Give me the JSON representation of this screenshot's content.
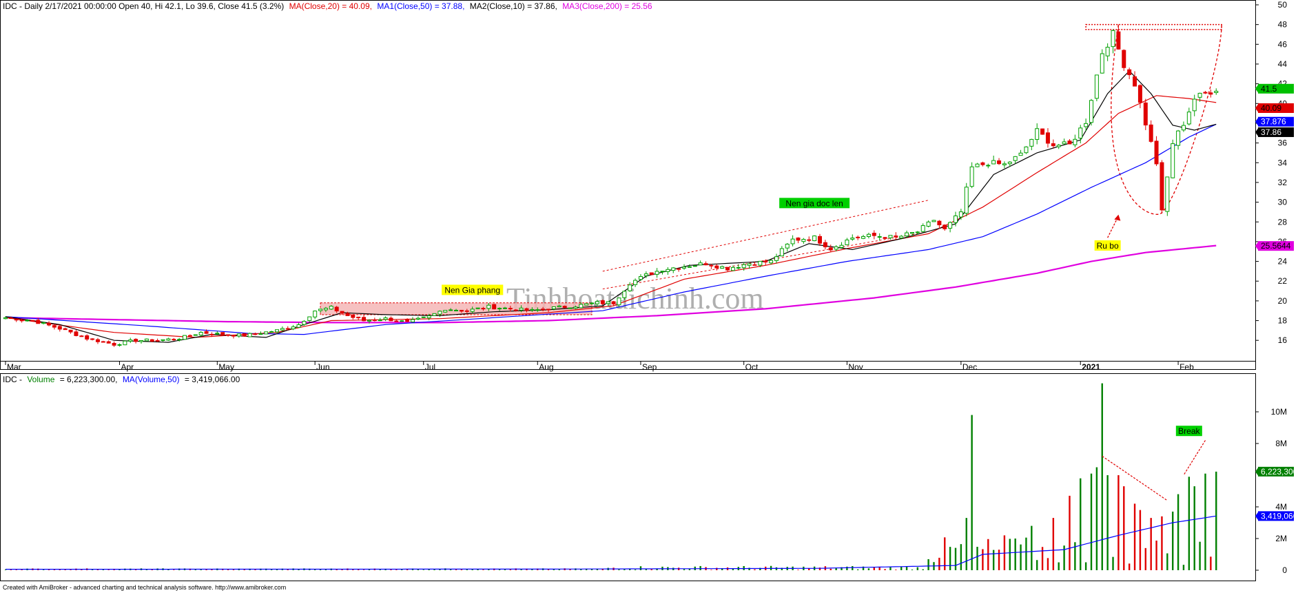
{
  "header": {
    "price_line": {
      "base": "IDC - Daily 2/17/2021 00:00:00 Open 40, Hi 42.1, Lo 39.6, Close 41.5 (3.2%)",
      "ma20": "MA(Close,20) = 40.09,",
      "ma50": "MA1(Close,50) = 37.88,",
      "ma10": "MA2(Close,10) = 37.86,",
      "ma200": "MA3(Close,200) = 25.56"
    },
    "volume_line": {
      "base": "IDC -",
      "vol_label": "Volume",
      "vol_value": "= 6,223,300.00,",
      "vol_ma": "MA(Volume,50)",
      "vol_ma_value": "= 3,419,066.00"
    }
  },
  "footer": "Created with AmiBroker - advanced charting and technical analysis software. http://www.amibroker.com",
  "watermark": "Tinhhoataichinh.com",
  "colors": {
    "up_candle": "#00a000",
    "down_candle": "#e00000",
    "ma20": "#e00000",
    "ma50": "#0000ff",
    "ma10": "#000000",
    "ma200": "#e000e0",
    "vol_up": "#008000",
    "vol_down": "#e00000",
    "vol_ma": "#0000ff",
    "zone_fill": "#f4b6b6"
  },
  "chart_data": [
    {
      "type": "line",
      "subtype": "candlestick",
      "title": "IDC - Daily",
      "ylim": [
        14.2,
        50
      ],
      "y_ticks": [
        16,
        18,
        20,
        22,
        24,
        26,
        28,
        30,
        32,
        34,
        36,
        38,
        40,
        42,
        44,
        46,
        48,
        50
      ],
      "months": [
        {
          "label": "Mar",
          "bar": 0
        },
        {
          "label": "Apr",
          "bar": 21
        },
        {
          "label": "May",
          "bar": 39
        },
        {
          "label": "Jun",
          "bar": 57
        },
        {
          "label": "Jul",
          "bar": 77
        },
        {
          "label": "Aug",
          "bar": 98
        },
        {
          "label": "Sep",
          "bar": 117
        },
        {
          "label": "Oct",
          "bar": 136
        },
        {
          "label": "Nov",
          "bar": 155
        },
        {
          "label": "Dec",
          "bar": 176
        },
        {
          "label": "2021",
          "bar": 198
        },
        {
          "label": "Feb",
          "bar": 216
        }
      ],
      "bar_count": 224,
      "anchors": {
        "close": [
          [
            0,
            18.3
          ],
          [
            5,
            18.0
          ],
          [
            10,
            17.2
          ],
          [
            15,
            16.2
          ],
          [
            20,
            15.6
          ],
          [
            24,
            16.0
          ],
          [
            28,
            16.0
          ],
          [
            32,
            16.2
          ],
          [
            36,
            16.8
          ],
          [
            40,
            16.6
          ],
          [
            44,
            16.5
          ],
          [
            50,
            17.0
          ],
          [
            54,
            17.6
          ],
          [
            57,
            19.0
          ],
          [
            60,
            19.3
          ],
          [
            63,
            18.5
          ],
          [
            66,
            18.0
          ],
          [
            70,
            18.2
          ],
          [
            74,
            17.8
          ],
          [
            78,
            18.4
          ],
          [
            81,
            19.2
          ],
          [
            85,
            19.0
          ],
          [
            89,
            19.4
          ],
          [
            93,
            19.2
          ],
          [
            97,
            19.0
          ],
          [
            101,
            19.3
          ],
          [
            105,
            19.5
          ],
          [
            109,
            19.8
          ],
          [
            112,
            19.8
          ],
          [
            115,
            21.8
          ],
          [
            118,
            22.6
          ],
          [
            121,
            23.2
          ],
          [
            125,
            23.5
          ],
          [
            129,
            23.8
          ],
          [
            133,
            23.3
          ],
          [
            137,
            23.8
          ],
          [
            141,
            24.0
          ],
          [
            145,
            26.2
          ],
          [
            149,
            26.4
          ],
          [
            152,
            25.3
          ],
          [
            156,
            26.4
          ],
          [
            160,
            26.6
          ],
          [
            164,
            26.4
          ],
          [
            168,
            27.0
          ],
          [
            171,
            28.2
          ],
          [
            173,
            27.2
          ],
          [
            176,
            29.0
          ],
          [
            178,
            33.5
          ],
          [
            181,
            34.0
          ],
          [
            184,
            33.8
          ],
          [
            187,
            34.8
          ],
          [
            190,
            37.2
          ],
          [
            193,
            35.8
          ],
          [
            196,
            35.8
          ],
          [
            199,
            38.2
          ],
          [
            202,
            45.2
          ],
          [
            204,
            47.0
          ],
          [
            206,
            44.0
          ],
          [
            208,
            42.0
          ],
          [
            210,
            38.0
          ],
          [
            212,
            34.0
          ],
          [
            213,
            29.0
          ],
          [
            215,
            36.0
          ],
          [
            217,
            38.0
          ],
          [
            219,
            40.5
          ],
          [
            221,
            41.0
          ],
          [
            223,
            41.5
          ]
        ],
        "ma20": [
          [
            0,
            18.3
          ],
          [
            20,
            16.8
          ],
          [
            35,
            16.3
          ],
          [
            50,
            16.8
          ],
          [
            60,
            18.0
          ],
          [
            80,
            18.2
          ],
          [
            100,
            18.8
          ],
          [
            112,
            19.5
          ],
          [
            125,
            22.2
          ],
          [
            140,
            23.6
          ],
          [
            155,
            25.3
          ],
          [
            170,
            26.8
          ],
          [
            180,
            29.5
          ],
          [
            190,
            33.0
          ],
          [
            199,
            36.0
          ],
          [
            205,
            39.0
          ],
          [
            212,
            40.8
          ],
          [
            218,
            40.5
          ],
          [
            223,
            40.1
          ]
        ],
        "ma50": [
          [
            0,
            18.4
          ],
          [
            25,
            17.5
          ],
          [
            45,
            16.7
          ],
          [
            55,
            16.6
          ],
          [
            70,
            17.6
          ],
          [
            90,
            18.3
          ],
          [
            110,
            19.0
          ],
          [
            125,
            20.9
          ],
          [
            140,
            22.5
          ],
          [
            155,
            24.0
          ],
          [
            170,
            25.2
          ],
          [
            180,
            26.5
          ],
          [
            190,
            28.8
          ],
          [
            200,
            31.5
          ],
          [
            210,
            34.0
          ],
          [
            218,
            36.6
          ],
          [
            223,
            37.9
          ]
        ],
        "ma10": [
          [
            0,
            18.4
          ],
          [
            10,
            17.6
          ],
          [
            20,
            16.0
          ],
          [
            30,
            15.8
          ],
          [
            38,
            16.6
          ],
          [
            48,
            16.3
          ],
          [
            55,
            17.6
          ],
          [
            62,
            18.8
          ],
          [
            70,
            18.6
          ],
          [
            80,
            18.5
          ],
          [
            90,
            18.9
          ],
          [
            100,
            19.1
          ],
          [
            110,
            19.5
          ],
          [
            118,
            22.5
          ],
          [
            126,
            23.6
          ],
          [
            140,
            24.0
          ],
          [
            148,
            25.8
          ],
          [
            156,
            25.2
          ],
          [
            165,
            26.3
          ],
          [
            175,
            27.8
          ],
          [
            182,
            32.8
          ],
          [
            190,
            35.0
          ],
          [
            198,
            36.3
          ],
          [
            203,
            41.0
          ],
          [
            207,
            43.3
          ],
          [
            211,
            41.0
          ],
          [
            215,
            37.8
          ],
          [
            219,
            37.3
          ],
          [
            223,
            37.9
          ]
        ],
        "ma200": [
          [
            0,
            18.3
          ],
          [
            40,
            17.9
          ],
          [
            60,
            17.8
          ],
          [
            80,
            17.8
          ],
          [
            100,
            18.0
          ],
          [
            120,
            18.5
          ],
          [
            140,
            19.2
          ],
          [
            160,
            20.3
          ],
          [
            175,
            21.4
          ],
          [
            190,
            22.8
          ],
          [
            200,
            24.0
          ],
          [
            210,
            24.9
          ],
          [
            223,
            25.6
          ]
        ]
      },
      "last_values": {
        "close": "41.5",
        "ma20": "40.09",
        "ma50": "37.876",
        "ma10": "37.86",
        "ma200": "25.5644"
      },
      "annotations": [
        {
          "text": "Nen Gia phang",
          "bar": 86,
          "y": 20.8,
          "style": "yellow"
        },
        {
          "text": "Nen gia doc len",
          "bar": 149,
          "y": 29.6,
          "style": "green"
        },
        {
          "text": "Ru bo",
          "bar": 203,
          "y": 25.3,
          "style": "yellow"
        }
      ],
      "zones": {
        "base": {
          "from_bar": 58,
          "to_bar": 108,
          "y_low": 18.6,
          "y_high": 19.8
        },
        "channel_upper": [
          [
            110,
            23.0
          ],
          [
            170,
            30.2
          ]
        ],
        "channel_lower": [
          [
            110,
            21.2
          ],
          [
            170,
            27.0
          ]
        ],
        "top_band": {
          "from_bar": 199,
          "to_bar": 224,
          "y_low": 47.5,
          "y_high": 48.0
        },
        "cup": {
          "left_bar": 205,
          "right_bar": 224,
          "top": 48.0,
          "bottom": 28.8
        },
        "arrow_from": [
          203,
          26.4
        ],
        "arrow_to": [
          205,
          28.6
        ]
      }
    },
    {
      "type": "bar",
      "title": "IDC - Volume",
      "unit": "shares",
      "ylim": [
        0,
        12000000
      ],
      "y_ticks": [
        {
          "v": 0,
          "label": "0"
        },
        {
          "v": 2000000,
          "label": "2M"
        },
        {
          "v": 4000000,
          "label": "4M"
        },
        {
          "v": 8000000,
          "label": "8M"
        },
        {
          "v": 10000000,
          "label": "10M"
        }
      ],
      "last_values": {
        "volume": "6,223,300",
        "vol_ma": "3,419,066"
      },
      "spikes": [
        {
          "bar": 178,
          "value": 9800000
        },
        {
          "bar": 177,
          "value": 3300000
        },
        {
          "bar": 202,
          "value": 11800000
        },
        {
          "bar": 184,
          "value": 2200000
        },
        {
          "bar": 186,
          "value": 2000000
        },
        {
          "bar": 189,
          "value": 2800000
        },
        {
          "bar": 193,
          "value": 3300000
        },
        {
          "bar": 196,
          "value": 4700000
        },
        {
          "bar": 198,
          "value": 5800000
        },
        {
          "bar": 200,
          "value": 6100000
        },
        {
          "bar": 201,
          "value": 6500000
        },
        {
          "bar": 203,
          "value": 6000000
        },
        {
          "bar": 205,
          "value": 6000000
        },
        {
          "bar": 206,
          "value": 5300000
        },
        {
          "bar": 208,
          "value": 4200000
        },
        {
          "bar": 209,
          "value": 3800000
        },
        {
          "bar": 211,
          "value": 3300000
        },
        {
          "bar": 213,
          "value": 3400000
        },
        {
          "bar": 215,
          "value": 3700000
        },
        {
          "bar": 216,
          "value": 4800000
        },
        {
          "bar": 218,
          "value": 5900000
        },
        {
          "bar": 219,
          "value": 5300000
        },
        {
          "bar": 221,
          "value": 6100000
        },
        {
          "bar": 223,
          "value": 6223300
        }
      ],
      "vol_ma_anchors": [
        [
          0,
          60000
        ],
        [
          100,
          70000
        ],
        [
          150,
          120000
        ],
        [
          175,
          300000
        ],
        [
          180,
          1000000
        ],
        [
          195,
          1300000
        ],
        [
          205,
          2200000
        ],
        [
          215,
          3000000
        ],
        [
          223,
          3420000
        ]
      ],
      "annotations": [
        {
          "text": "Break",
          "bar": 218,
          "value": 8600000,
          "style": "green"
        }
      ]
    }
  ]
}
